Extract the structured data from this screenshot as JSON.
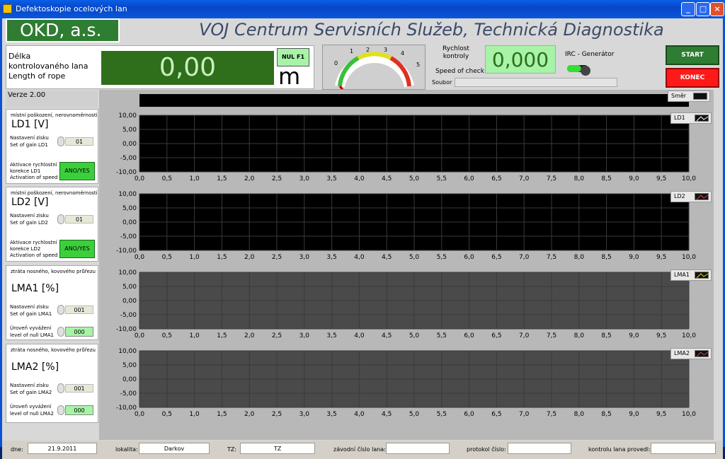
{
  "window": {
    "title": "Defektoskopie ocelových lan"
  },
  "header": {
    "company": "OKD, a.s.",
    "title": "VOJ Centrum Servisních Služeb, Technická Diagnostika"
  },
  "length": {
    "label1": "Délka",
    "label2": "kontrolovaného lana",
    "label3": "Length of rope",
    "value": "0,00",
    "null_label": "NUL F1",
    "unit": "m"
  },
  "gauge": {
    "ticks": [
      "0",
      "1",
      "2",
      "3",
      "4",
      "5"
    ],
    "value": 0
  },
  "speed": {
    "label1": "Rychlost",
    "label2": "kontroly",
    "value": "0,000",
    "label_en": "Speed of check",
    "file_label": "Soubor",
    "file_value": ""
  },
  "irc": {
    "label": "IRC - Generátor"
  },
  "buttons": {
    "start": "START",
    "end": "KONEC"
  },
  "version": "Verze 2.00",
  "direction": {
    "label": "Směr"
  },
  "x_ticks": [
    "0,0",
    "0,5",
    "1,0",
    "1,5",
    "2,0",
    "2,5",
    "3,0",
    "3,5",
    "4,0",
    "4,5",
    "5,0",
    "5,5",
    "6,0",
    "6,5",
    "7,0",
    "7,5",
    "8,0",
    "8,5",
    "9,0",
    "9,5",
    "10,0"
  ],
  "y_ticks": [
    "10,00",
    "5,00",
    "0,00",
    "-5,00",
    "-10,00"
  ],
  "channels": [
    {
      "sub": "místní poškození, nerovnoměrnosti",
      "name": "LD1   [V]",
      "gain_label1": "Nastavení zisku",
      "gain_label2": "Set of gain LD1",
      "gain": "01",
      "act1": "Aktivace rychlostní",
      "act2": "korekce LD1",
      "act3": "Activation of speed",
      "act_btn": "ANO/YES",
      "legend": "LD1",
      "color": "#ffffff"
    },
    {
      "sub": "místní poškození, nerovnoměrnosti",
      "name": "LD2   [V]",
      "gain_label1": "Nastavení zisku",
      "gain_label2": "Set of gain LD2",
      "gain": "01",
      "act1": "Aktivace rychlostní",
      "act2": "korekce LD2",
      "act3": "Activation of speed",
      "act_btn": "ANO/YES",
      "legend": "LD2",
      "color": "#ff3030"
    },
    {
      "sub": "ztráta nosného, kovového průřezu",
      "name": "LMA1   [%]",
      "gain_label1": "Nastavení zisku",
      "gain_label2": "Set of gain LMA1",
      "gain": "001",
      "null1": "Úroveň vyvážení",
      "null2": "level of null LMA1",
      "null_val": "000",
      "legend": "LMA1",
      "color": "#e8e000"
    },
    {
      "sub": "ztráta nosného, kovového průřezu",
      "name": "LMA2   [%]",
      "gain_label1": "Nastavení zisku",
      "gain_label2": "Set of gain LMA2",
      "gain": "001",
      "null1": "Úroveň vyvážení",
      "null2": "level of null LMA2",
      "null_val": "000",
      "legend": "LMA2",
      "color": "#b05050"
    }
  ],
  "status": {
    "date_label": "dne:",
    "date": "21.9.2011",
    "loc_label": "lokalita:",
    "loc": "Darkov",
    "tz_label": "TZ:",
    "tz": "TZ",
    "rope_label": "závodní číslo lana:",
    "rope": "",
    "protocol_label": "protokol číslo:",
    "protocol": "",
    "inspector_label": "kontrolu lana provedl:",
    "inspector": ""
  }
}
